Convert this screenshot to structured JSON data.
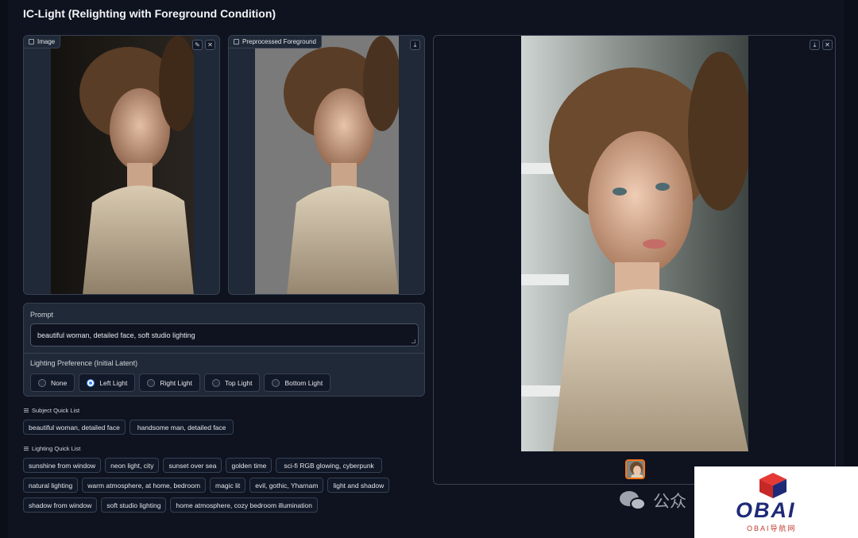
{
  "app": {
    "title": "IC-Light (Relighting with Foreground Condition)"
  },
  "input_image": {
    "label": "Image",
    "edit_icon": "pencil-icon",
    "clear_icon": "close-icon"
  },
  "preprocessed": {
    "label": "Preprocessed Foreground",
    "download_icon": "download-icon"
  },
  "output": {
    "download_icon": "download-icon",
    "clear_icon": "close-icon"
  },
  "prompt": {
    "label": "Prompt",
    "value": "beautiful woman, detailed face, soft studio lighting"
  },
  "lighting": {
    "label": "Lighting Preference (Initial Latent)",
    "options": [
      "None",
      "Left Light",
      "Right Light",
      "Top Light",
      "Bottom Light"
    ],
    "selected": "Left Light"
  },
  "subject_list": {
    "label": "Subject Quick List",
    "items": [
      "beautiful woman, detailed face",
      "handsome man, detailed face"
    ]
  },
  "lighting_list": {
    "label": "Lighting Quick List",
    "rows": [
      [
        "sunshine from window",
        "neon light, city",
        "sunset over sea",
        "golden time",
        "sci-fi RGB glowing, cyberpunk"
      ],
      [
        "natural lighting",
        "warm atmosphere, at home, bedroom",
        "magic lit",
        "evil, gothic, Yharnam",
        "light and shadow"
      ],
      [
        "shadow from window",
        "soft studio lighting",
        "home atmosphere, cozy bedroom illumination"
      ]
    ]
  },
  "watermark": {
    "wechat_text": "公众",
    "brand": "OBAI",
    "brand_sub": "OBAI导航网"
  },
  "colors": {
    "accent": "#3b82f6",
    "thumb_border": "#f97316",
    "background": "#0b0f19"
  }
}
